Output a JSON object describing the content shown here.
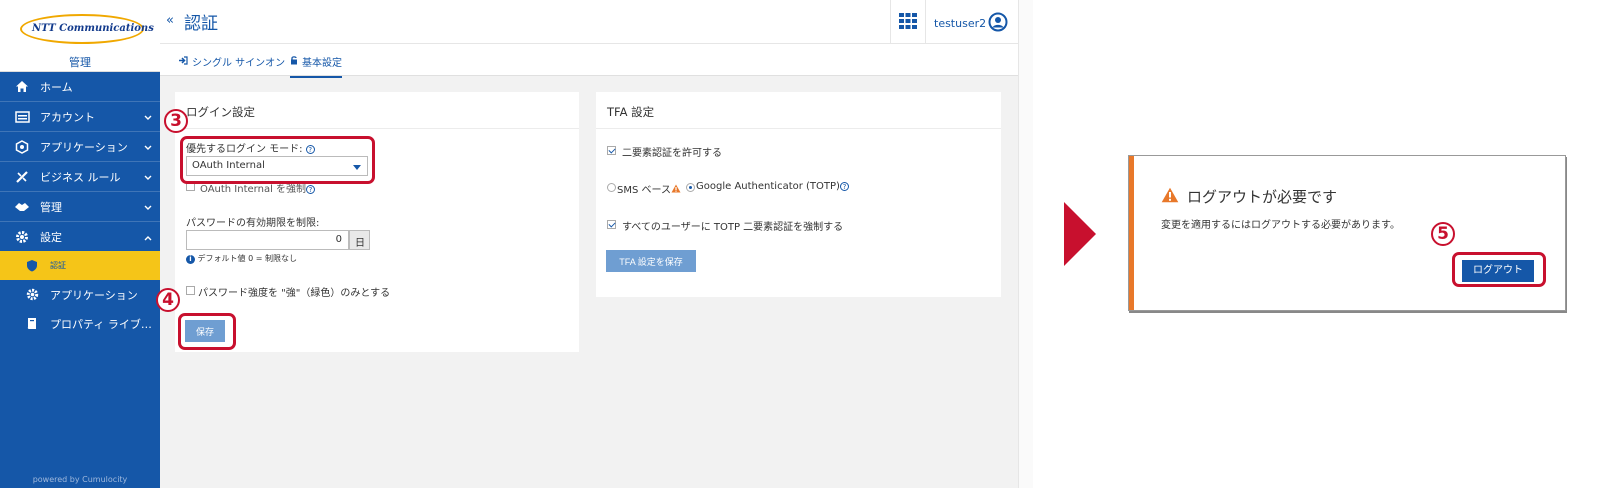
{
  "sidebar": {
    "logo_text": "NTT Communications",
    "brand_sub": "管理",
    "items": [
      {
        "label": "ホーム"
      },
      {
        "label": "アカウント"
      },
      {
        "label": "アプリケーション"
      },
      {
        "label": "ビジネス ルール"
      },
      {
        "label": "管理"
      },
      {
        "label": "設定"
      }
    ],
    "sub_items": [
      {
        "label": "認証"
      },
      {
        "label": "アプリケーション"
      },
      {
        "label": "プロパティ ライブ…"
      }
    ],
    "powered": "powered by Cumulocity"
  },
  "header": {
    "collapse": "«",
    "title": "認証",
    "user": "testuser2"
  },
  "tabs": [
    {
      "label": "シングル サインオン"
    },
    {
      "label": "基本設定"
    }
  ],
  "login_card": {
    "title": "ログイン設定",
    "mode_label": "優先するログイン モード:",
    "mode_value": "OAuth Internal",
    "force_label": "OAuth Internal を強制",
    "pwd_limit_label": "パスワードの有効期限を制限:",
    "pwd_limit_value": "0",
    "pwd_limit_unit": "日",
    "default_note": "デフォルト値 0 = 制限なし",
    "strong_label": "パスワード強度を \"強\"（緑色）のみとする",
    "save_label": "保存"
  },
  "tfa_card": {
    "title": "TFA 設定",
    "allow_label": "二要素認証を許可する",
    "sms_label": "SMS ベース",
    "google_label": "Google Authenticator (TOTP)",
    "enforce_label": "すべてのユーザーに TOTP 二要素認証を強制する",
    "save_label": "TFA 設定を保存"
  },
  "steps": {
    "s3": "3",
    "s4": "4",
    "s5": "5"
  },
  "dialog": {
    "title": "ログアウトが必要です",
    "body": "変更を適用するにはログアウトする必要があります。",
    "button": "ログアウト"
  },
  "colors": {
    "brand": "#1557a8",
    "active": "#f5c518",
    "highlight": "#c8102e",
    "warning": "#e8782a"
  },
  "icons": [
    "home-icon",
    "account-icon",
    "applications-icon",
    "business-rules-icon",
    "admin-icon",
    "settings-icon",
    "shield-icon",
    "gear-icon",
    "book-icon",
    "app-grid-icon",
    "user-avatar-icon",
    "warning-icon",
    "info-icon",
    "help-icon",
    "signin-icon",
    "lock-icon"
  ]
}
